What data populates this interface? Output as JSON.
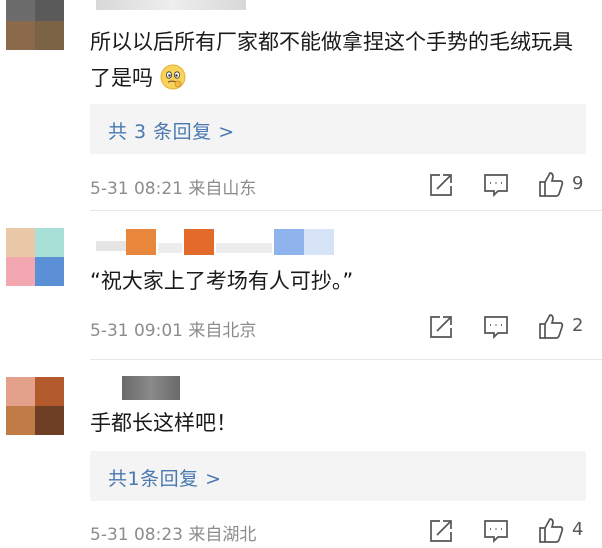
{
  "comments": [
    {
      "text": "所以以后所有厂家都不能做拿捏这个手势的毛绒玩具了是吗",
      "emoji": "thinking-emoji",
      "reply_label": "共 3 条回复 >",
      "time": "5-31 08:21",
      "location": "来自山东",
      "likes": "9"
    },
    {
      "text": "“祝大家上了考场有人可抄。”",
      "time": "5-31 09:01",
      "location": "来自北京",
      "likes": "2"
    },
    {
      "text": "手都长这样吧！",
      "reply_label": "共1条回复 >",
      "time": "5-31 08:23",
      "location": "来自湖北",
      "likes": "4"
    }
  ],
  "colors": {
    "link": "#4a78b0",
    "meta": "#8c8c8c",
    "reply_bg": "#f4f4f4"
  },
  "icons": [
    "share-icon",
    "comment-icon",
    "like-icon"
  ]
}
